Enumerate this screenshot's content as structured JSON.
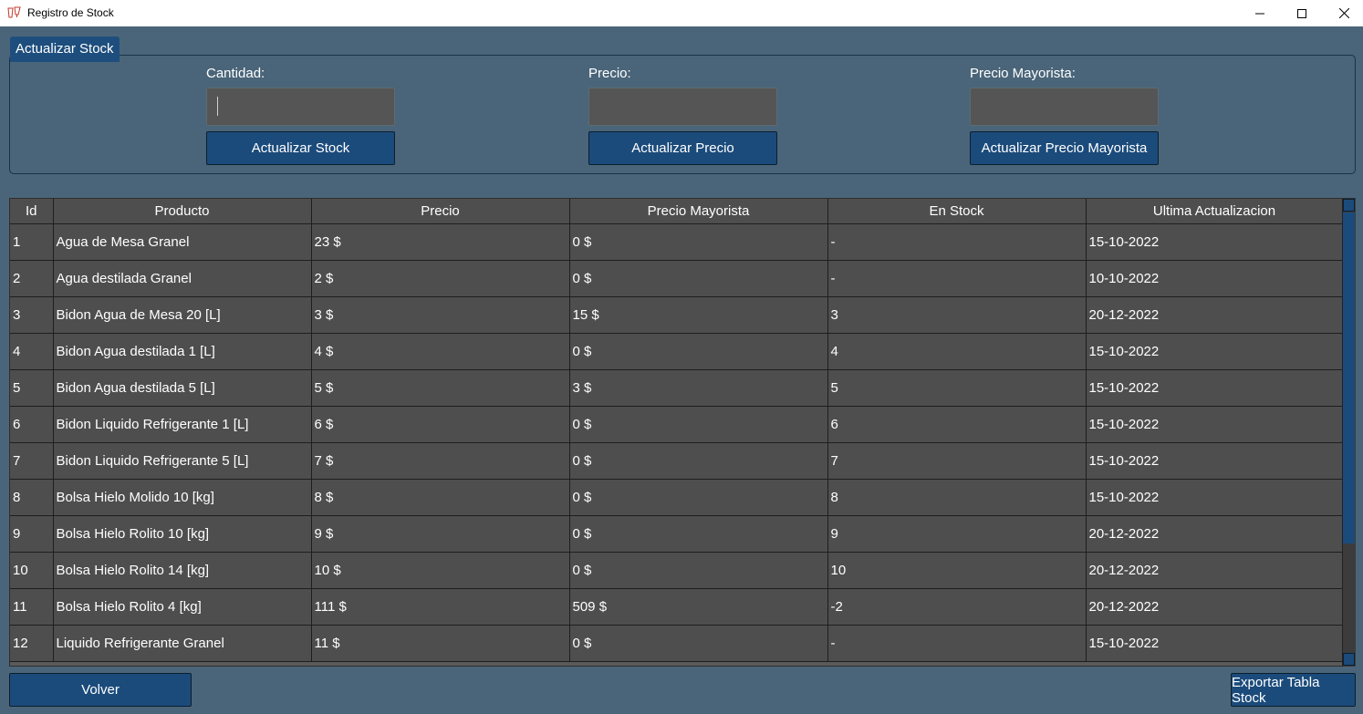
{
  "window": {
    "title": "Registro de Stock",
    "app_icon": "glass-icon",
    "controls": [
      "minimize-icon",
      "maximize-icon",
      "close-icon"
    ]
  },
  "group": {
    "title": "Actualizar Stock",
    "fields": [
      {
        "label": "Cantidad:",
        "value": "",
        "placeholder": "",
        "button": "Actualizar Stock"
      },
      {
        "label": "Precio:",
        "value": "",
        "placeholder": "",
        "button": "Actualizar Precio"
      },
      {
        "label": "Precio Mayorista:",
        "value": "",
        "placeholder": "",
        "button": "Actualizar Precio Mayorista"
      }
    ]
  },
  "table": {
    "columns": [
      "Id",
      "Producto",
      "Precio",
      "Precio Mayorista",
      "En Stock",
      "Ultima Actualizacion"
    ],
    "rows": [
      [
        "1",
        "Agua de Mesa Granel",
        "23 $",
        "0 $",
        "-",
        "15-10-2022"
      ],
      [
        "2",
        "Agua destilada Granel",
        "2 $",
        "0 $",
        "-",
        "10-10-2022"
      ],
      [
        "3",
        "Bidon Agua de Mesa 20 [L]",
        "3 $",
        "15 $",
        "3",
        "20-12-2022"
      ],
      [
        "4",
        "Bidon Agua destilada 1 [L]",
        "4 $",
        "0 $",
        "4",
        "15-10-2022"
      ],
      [
        "5",
        "Bidon Agua destilada 5 [L]",
        "5 $",
        "3 $",
        "5",
        "15-10-2022"
      ],
      [
        "6",
        "Bidon Liquido Refrigerante 1 [L]",
        "6 $",
        "0 $",
        "6",
        "15-10-2022"
      ],
      [
        "7",
        "Bidon Liquido Refrigerante 5 [L]",
        "7 $",
        "0 $",
        "7",
        "15-10-2022"
      ],
      [
        "8",
        "Bolsa Hielo Molido 10 [kg]",
        "8 $",
        "0 $",
        "8",
        "15-10-2022"
      ],
      [
        "9",
        "Bolsa Hielo Rolito 10 [kg]",
        "9 $",
        "0 $",
        "9",
        "20-12-2022"
      ],
      [
        "10",
        "Bolsa Hielo Rolito 14 [kg]",
        "10 $",
        "0 $",
        "10",
        "20-12-2022"
      ],
      [
        "11",
        "Bolsa Hielo Rolito 4 [kg]",
        "111 $",
        "509 $",
        "-2",
        "20-12-2022"
      ],
      [
        "12",
        "Liquido Refrigerante Granel",
        "11 $",
        "0 $",
        "-",
        "15-10-2022"
      ]
    ]
  },
  "footer": {
    "back_label": "Volver",
    "export_label": "Exportar Tabla Stock"
  },
  "colors": {
    "background": "#4a6579",
    "accent": "#1b4b7b",
    "cell": "#4e4e4e"
  }
}
